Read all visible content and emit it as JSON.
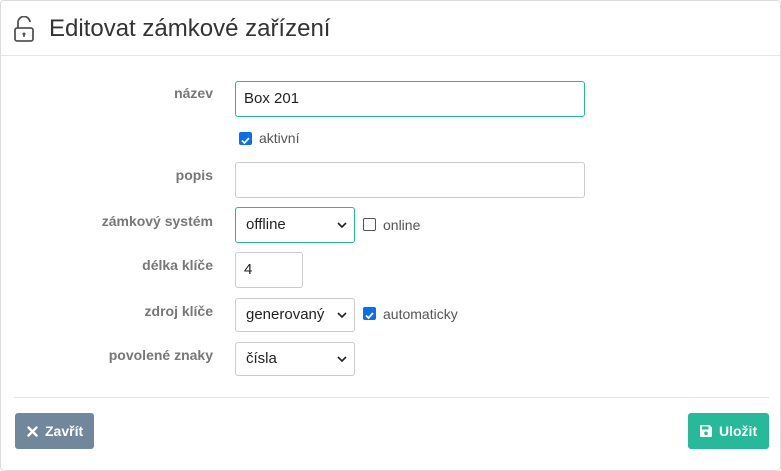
{
  "header": {
    "title": "Editovat zámkové zařízení",
    "icon": "unlock-icon"
  },
  "form": {
    "name_label": "název",
    "name_value": "Box 201",
    "active_label": "aktivní",
    "active_checked": true,
    "description_label": "popis",
    "description_value": "",
    "lock_system_label": "zámkový systém",
    "lock_system_value": "offline",
    "online_label": "online",
    "online_checked": false,
    "key_length_label": "délka klíče",
    "key_length_value": "4",
    "key_source_label": "zdroj klíče",
    "key_source_value": "generovaný",
    "automatic_label": "automaticky",
    "automatic_checked": true,
    "allowed_chars_label": "povolené znaky",
    "allowed_chars_value": "čísla"
  },
  "footer": {
    "close_label": "Zavřít",
    "save_label": "Uložit"
  },
  "colors": {
    "accent": "#26b99a",
    "secondary": "#73879c",
    "checkbox": "#0a6ef0"
  }
}
